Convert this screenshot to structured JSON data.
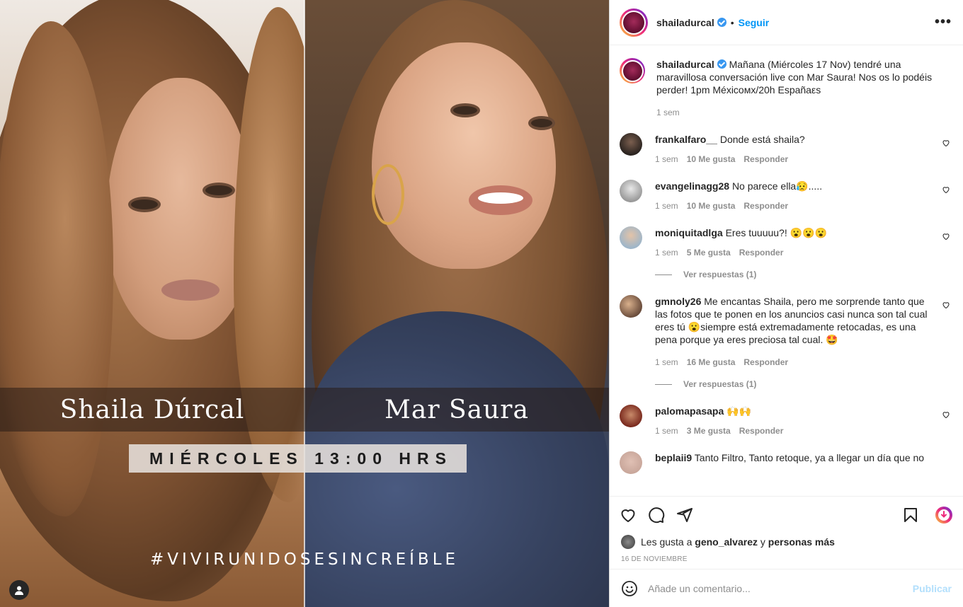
{
  "post": {
    "username": "shailadurcal",
    "follow_label": "Seguir",
    "separator": "•",
    "more_label": "•••",
    "caption": "Mañana (Miércoles 17 Nov) tendré una maravillosa conversación live con Mar Saura! Nos os lo podéis perder! 1pm Méxicoмх/20h Españaεs",
    "caption_time": "1 sem"
  },
  "media": {
    "left_name": "Shaila Dúrcal",
    "right_name": "Mar Saura",
    "event_time": "MIÉRCOLES 13:00 HRS",
    "hashtag": "#VIVIRUNIDOSESINCREÍBLE"
  },
  "comments": [
    {
      "user": "frankalfaro__",
      "text": "Donde está shaila?",
      "time": "1 sem",
      "likes": "10 Me gusta",
      "reply": "Responder",
      "avatar_color": "#2b2420"
    },
    {
      "user": "evangelinagg28",
      "text": "No parece ella😥.....",
      "time": "1 sem",
      "likes": "10 Me gusta",
      "reply": "Responder",
      "avatar_color": "#bdbdbd"
    },
    {
      "user": "moniquitadlga",
      "text": "Eres tuuuuu?! 😮😮😮",
      "time": "1 sem",
      "likes": "5 Me gusta",
      "reply": "Responder",
      "avatar_color": "#9fb6c9",
      "replies_label": "Ver respuestas (1)"
    },
    {
      "user": "gmnoly26",
      "text": "Me encantas Shaila, pero me sorprende tanto que las fotos que te ponen en los anuncios casi nunca son tal cual eres tú 😮siempre está extremadamente retocadas, es una pena porque ya eres preciosa tal cual. 🤩",
      "time": "1 sem",
      "likes": "16 Me gusta",
      "reply": "Responder",
      "avatar_color": "#6b4d3c",
      "replies_label": "Ver respuestas (1)"
    },
    {
      "user": "palomapasapa",
      "text": "🙌🙌",
      "time": "1 sem",
      "likes": "3 Me gusta",
      "reply": "Responder",
      "avatar_color": "#7a2a1e"
    },
    {
      "user": "beplaii9",
      "text": "Tanto Filtro, Tanto retoque, ya a llegar un día que no",
      "time": "",
      "likes": "",
      "reply": "",
      "avatar_color": "#c9a79b"
    }
  ],
  "likes_row": {
    "prefix": "Les gusta a",
    "user": "geno_alvarez",
    "conj": "y",
    "others": "personas más"
  },
  "post_date": "16 DE NOVIEMBRE",
  "composer": {
    "placeholder": "Añade un comentario...",
    "publish_label": "Publicar"
  },
  "colors": {
    "accent": "#0095f6",
    "verified": "#3897f0",
    "publish_disabled": "#b2dffc",
    "secondary_text": "#8e8e8e"
  },
  "icons": [
    "heart-icon",
    "comment-icon",
    "share-icon",
    "bookmark-icon",
    "download-icon",
    "smile-icon",
    "more-icon",
    "verified-icon",
    "user-tag-icon"
  ]
}
